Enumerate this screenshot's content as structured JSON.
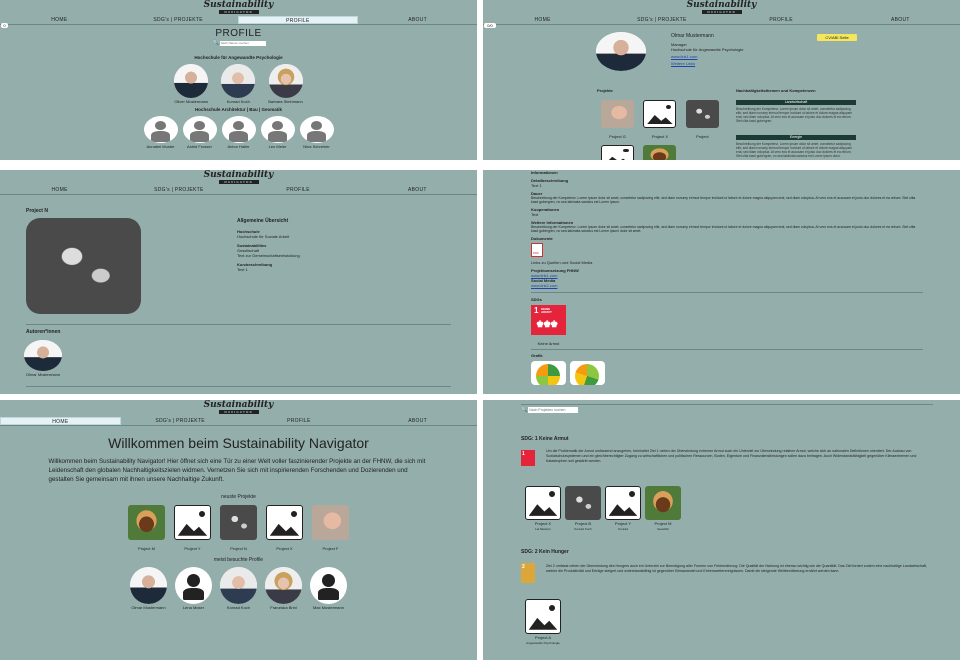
{
  "brand": {
    "name": "Sustainability",
    "sub": "NAVIGATOR"
  },
  "nav": {
    "home": "HOME",
    "projects": "SDG's | PROJEKTE",
    "profile": "PROFILE",
    "about": "ABOUT"
  },
  "p1": {
    "badge": "0",
    "title": "PROFILE",
    "search_placeholder": "Nach Namen suchen",
    "section1": "Hochschule für Angewandte Psychologie",
    "people1": [
      "Oliver Mustermann",
      "Konrad Koch",
      "Barbara Steinmann"
    ],
    "section2": "Hochschule Architektur | Bau | Geomatik",
    "people2": [
      "Annabel Muster",
      "Astrid Frosser",
      "Anton Haller",
      "Leo Meier",
      "Nina Schreiner"
    ]
  },
  "p2": {
    "badge": "0/0",
    "name": "Olmar Mustermann",
    "role": "Manager",
    "school": "Hochschule für Angewandte Psychologie",
    "link1": "www.link1.com",
    "link2": "Weitere Links",
    "btn": "CV/ABI Seite",
    "projekte_title": "Projekte",
    "projects": [
      "Project G",
      "Project X",
      "Project"
    ],
    "right_title": "Nachhaltigkeitsthemen und Kompetenzen",
    "tag1": "Landwirtschaft",
    "text1": "Beschreibung der Kompetenz. Lorem ipsum dolor sit amet, consetetur sadipscing elitr, sed diam nonumy eirmod tempor invidunt ut labore et dolore magna aliquyam erat, sed diam voluptua. At vero eos et accusam et justo duo dolores et ea rebum. Stet clita kasd gubergren.",
    "tag2": "Energie",
    "text2": "Beschreibung der Kompetenz. Lorem ipsum dolor sit amet, consetetur sadipscing elitr, sed diam nonumy eirmod tempor invidunt ut labore et dolore magna aliquyam erat, sed diam voluptua. At vero eos et accusam et justo duo dolores et ea rebum. Stet clita kasd gubergren, no sea takimata sanctus est Lorem ipsum dolor."
  },
  "p3": {
    "title": "Project N",
    "overview": "Allgemeine Übersicht",
    "k1": "Hochschule",
    "v1": "Hochschule für Soziale Arbeit",
    "k2": "Sustainabilities",
    "v2": "Gesellschaft",
    "v2b": "Text zur Gemeinschaftsentwicklung",
    "k3": "Kurzbeschreibung",
    "v3": "Text 1",
    "authors": "Autoren*innen",
    "author": "Olmar Mustermann"
  },
  "p4": {
    "info": "Informationen",
    "k1": "Detailbeschreibung",
    "v1": "Text 1",
    "k2": "Dauer",
    "v2": "Beschreibung der Kompetenz. Lorem ipsum dolor sit amet, consetetur sadipscing elitr, sed diam nonumy eirmod tempor invidunt ut labore et dolore magna aliquyam erat, sed diam voluptua. At vero eos et accusam et justo duo dolores et ea rebum. Stet clita kasd gubergren, no sea takimata sanctus est Lorem ipsum.",
    "k3": "Kooperationen",
    "v3": "Text",
    "k4": "Weitere Informationen",
    "v4": "Beschreibung der Kompetenz. Lorem ipsum dolor sit amet, consetetur sadipscing elitr, sed diam nonumy eirmod tempor invidunt ut labore et dolore magna aliquyam erat, sed diam voluptua. At vero eos et accusam et justo duo dolores et ea rebum. Stet clita kasd gubergren, no sea takimata sanctus est Lorem ipsum dolor sit amet.",
    "docs": "Dokumente",
    "pdf": "PDF",
    "links_title": "Links zu Quellen und Social Media",
    "lk1": "Projektumsetzung FHNW",
    "lv1": "www.link1.com",
    "lk2": "Social Media",
    "lv2": "www.link2.com",
    "sdgs": "SDGs",
    "sdg_num": "1",
    "sdg_label": "KEINE ARMUT",
    "sdg_cap": "Keine Armut",
    "grafik": "Grafik"
  },
  "p5": {
    "title": "Willkommen beim Sustainability Navigator",
    "intro": "Willkommen beim Sustainability Navigator! Hier öffnet sich eine Tür zu einer Welt voller faszinierender Projekte an der FHNW, die sich mit Leidenschaft den globalen Nachhaltigkeitszielen widmen. Vernetzen Sie sich mit inspirierenden Forschenden und Dozierenden und gestalten Sie gemeinsam mit ihnen unsere Nachhaltige Zukunft.",
    "neuste": "neuste Projekte",
    "projects": [
      "Project M",
      "Project Y",
      "Project N",
      "Project X",
      "Project F"
    ],
    "meist": "meist besuchte Profile",
    "profiles": [
      "Olmar Mustermann",
      "Lena Moser",
      "Konrad Koch",
      "Franziska Brini",
      "Max Mustermann"
    ]
  },
  "p6": {
    "search_placeholder": "Nach Projekten suchen",
    "sdg1": "SDG: 1 Keine Armut",
    "sdg1_text": "Um die Problematik der Armut umfassend anzugehen, beinhaltet Ziel 1 neben der Überwindung extremer Armut auch ein Unterziel zur Überwindung relativer Armut, welche sich an nationalen Definitionen orientiert. Der Ausbau von Sozialschutzsystemen und ein gleichberechtigter Zugang zu wirtschaftlichen und politischen Ressourcen, Boden, Eigentum und Finanzdienstleistungen sollen dazu beitragen. Auch Widerstandsfähigkeit gegenüber Klimaextremen und Katastrophen soll gestärkt werden.",
    "sdg1_projects": [
      "Project X",
      "Project B",
      "Project Y",
      "Project M"
    ],
    "sdg1_subs": [
      "Lia Mustern",
      "Konrad Koch",
      "Konrad",
      "Gesellstr"
    ],
    "sdg2": "SDG: 2 Kein Hunger",
    "sdg2_text": "Ziel 2 umfasst neben der Überwindung des Hungers auch ein Unterziel zur Beendigung aller Formen von Fehlernährung. Die Qualität der Nahrung ist ebenso wichtig wie die Quantität. Das Ziel fordert zudem eine nachhaltige Landwirtschaft, welche die Produktivität und Erträge steigert und widerstandsfähig ist gegenüber Klimawandel und Extremwetterereignissen. Damit die steigende Weltbevölkerung ernährt werden kann.",
    "sdg2_projects": [
      "Project A"
    ],
    "sdg2_subs": [
      "Angewandte Psychologie"
    ]
  },
  "colors": {
    "bg": "#93aeab",
    "accent": "#f5e65c",
    "sdg1": "#e5243b",
    "sdg2": "#dda63a"
  }
}
